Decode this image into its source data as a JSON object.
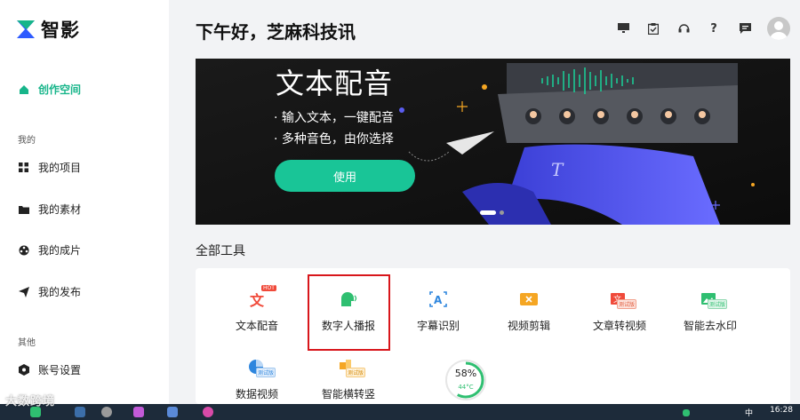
{
  "app": {
    "name": "智影",
    "brand_color": "#17b58a"
  },
  "sidebar": {
    "create_space": "创作空间",
    "section_mine": "我的",
    "items_mine": [
      {
        "label": "我的项目",
        "icon": "grid-icon"
      },
      {
        "label": "我的素材",
        "icon": "folder-icon"
      },
      {
        "label": "我的成片",
        "icon": "film-reel-icon"
      },
      {
        "label": "我的发布",
        "icon": "send-icon"
      }
    ],
    "section_other": "其他",
    "items_other": [
      {
        "label": "账号设置",
        "icon": "hexagon-gear-icon"
      }
    ]
  },
  "header": {
    "greeting": "下午好，芝麻科技讯",
    "icons": [
      "monitor-icon",
      "clipboard-icon",
      "headset-icon",
      "help-icon",
      "message-icon",
      "avatar"
    ]
  },
  "banner": {
    "title": "文本配音",
    "line1": "· 输入文本，一键配音",
    "line2": "· 多种音色，由你选择",
    "button": "使用",
    "slide_count": 2,
    "active_slide": 1
  },
  "tools": {
    "title": "全部工具",
    "items": [
      {
        "label": "文本配音",
        "icon": "text-voice-icon",
        "badge": "HOT",
        "color": "#f04a3a"
      },
      {
        "label": "数字人播报",
        "icon": "digital-human-icon",
        "color": "#2fbf71",
        "highlighted": true
      },
      {
        "label": "字幕识别",
        "icon": "subtitle-recognition-icon",
        "color": "#2e86de"
      },
      {
        "label": "视频剪辑",
        "icon": "video-edit-icon",
        "color": "#f5a623"
      },
      {
        "label": "文章转视频",
        "icon": "article-to-video-icon",
        "badge": "测试版",
        "color": "#f04a3a"
      },
      {
        "label": "智能去水印",
        "icon": "remove-watermark-icon",
        "badge": "测试版",
        "color": "#2fbf71"
      },
      {
        "label": "数据视频",
        "icon": "data-video-icon",
        "badge": "测试版",
        "color": "#2e86de"
      },
      {
        "label": "智能横转竖",
        "icon": "landscape-to-portrait-icon",
        "badge": "测试版",
        "color": "#f5a623"
      }
    ]
  },
  "overlay_gauge": {
    "percent": "58%",
    "temp": "44°C",
    "value": 0.58
  },
  "taskbar": {
    "time": "16:28",
    "ime": "中"
  },
  "watermark": "大数跨境"
}
